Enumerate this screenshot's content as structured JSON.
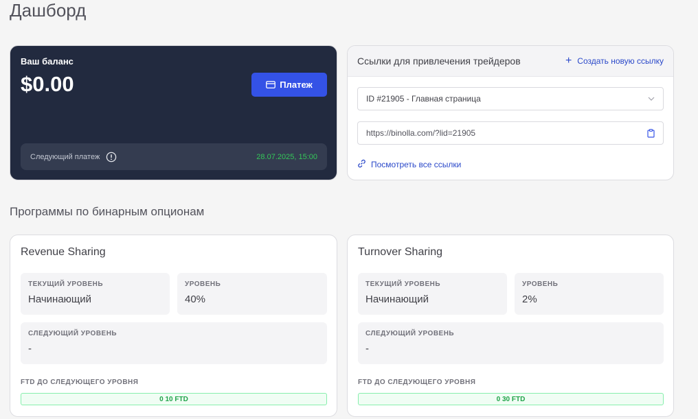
{
  "page": {
    "title": "Дашборд"
  },
  "balance": {
    "label": "Ваш баланс",
    "value": "$0.00",
    "pay_button": "Платеж",
    "next_payment_label": "Следующий платеж",
    "next_payment_date": "28.07.2025, 15:00"
  },
  "links": {
    "title": "Ссылки для привлечения трейдеров",
    "create_link": "Создать новую ссылку",
    "selected_link": "ID #21905 - Главная страница",
    "url": "https://binolla.com/?lid=21905",
    "view_all": "Посмотреть все ссылки"
  },
  "programs": {
    "section_title": "Программы по бинарным опционам",
    "items": [
      {
        "title": "Revenue Sharing",
        "current_level_label": "ТЕКУЩИЙ УРОВЕНЬ",
        "current_level_value": "Начинающий",
        "level_label": "УРОВЕНЬ",
        "level_value": "40%",
        "next_level_label": "СЛЕДУЮЩИЙ УРОВЕНЬ",
        "next_level_value": "-",
        "ftd_label": "FTD ДО СЛЕДУЮЩЕГО УРОВНЯ",
        "ftd_progress": "0 10 FTD"
      },
      {
        "title": "Turnover Sharing",
        "current_level_label": "ТЕКУЩИЙ УРОВЕНЬ",
        "current_level_value": "Начинающий",
        "level_label": "УРОВЕНЬ",
        "level_value": "2%",
        "next_level_label": "СЛЕДУЮЩИЙ УРОВЕНЬ",
        "next_level_value": "-",
        "ftd_label": "FTD ДО СЛЕДУЮЩЕГО УРОВНЯ",
        "ftd_progress": "0 30 FTD"
      }
    ]
  },
  "colors": {
    "accent": "#3452e6",
    "link": "#2a48c9",
    "dark_card": "#222a3f",
    "success": "#34c759"
  },
  "icons": [
    "card-icon",
    "info-icon",
    "plus-icon",
    "chevron-down-icon",
    "copy-icon",
    "link-icon"
  ]
}
